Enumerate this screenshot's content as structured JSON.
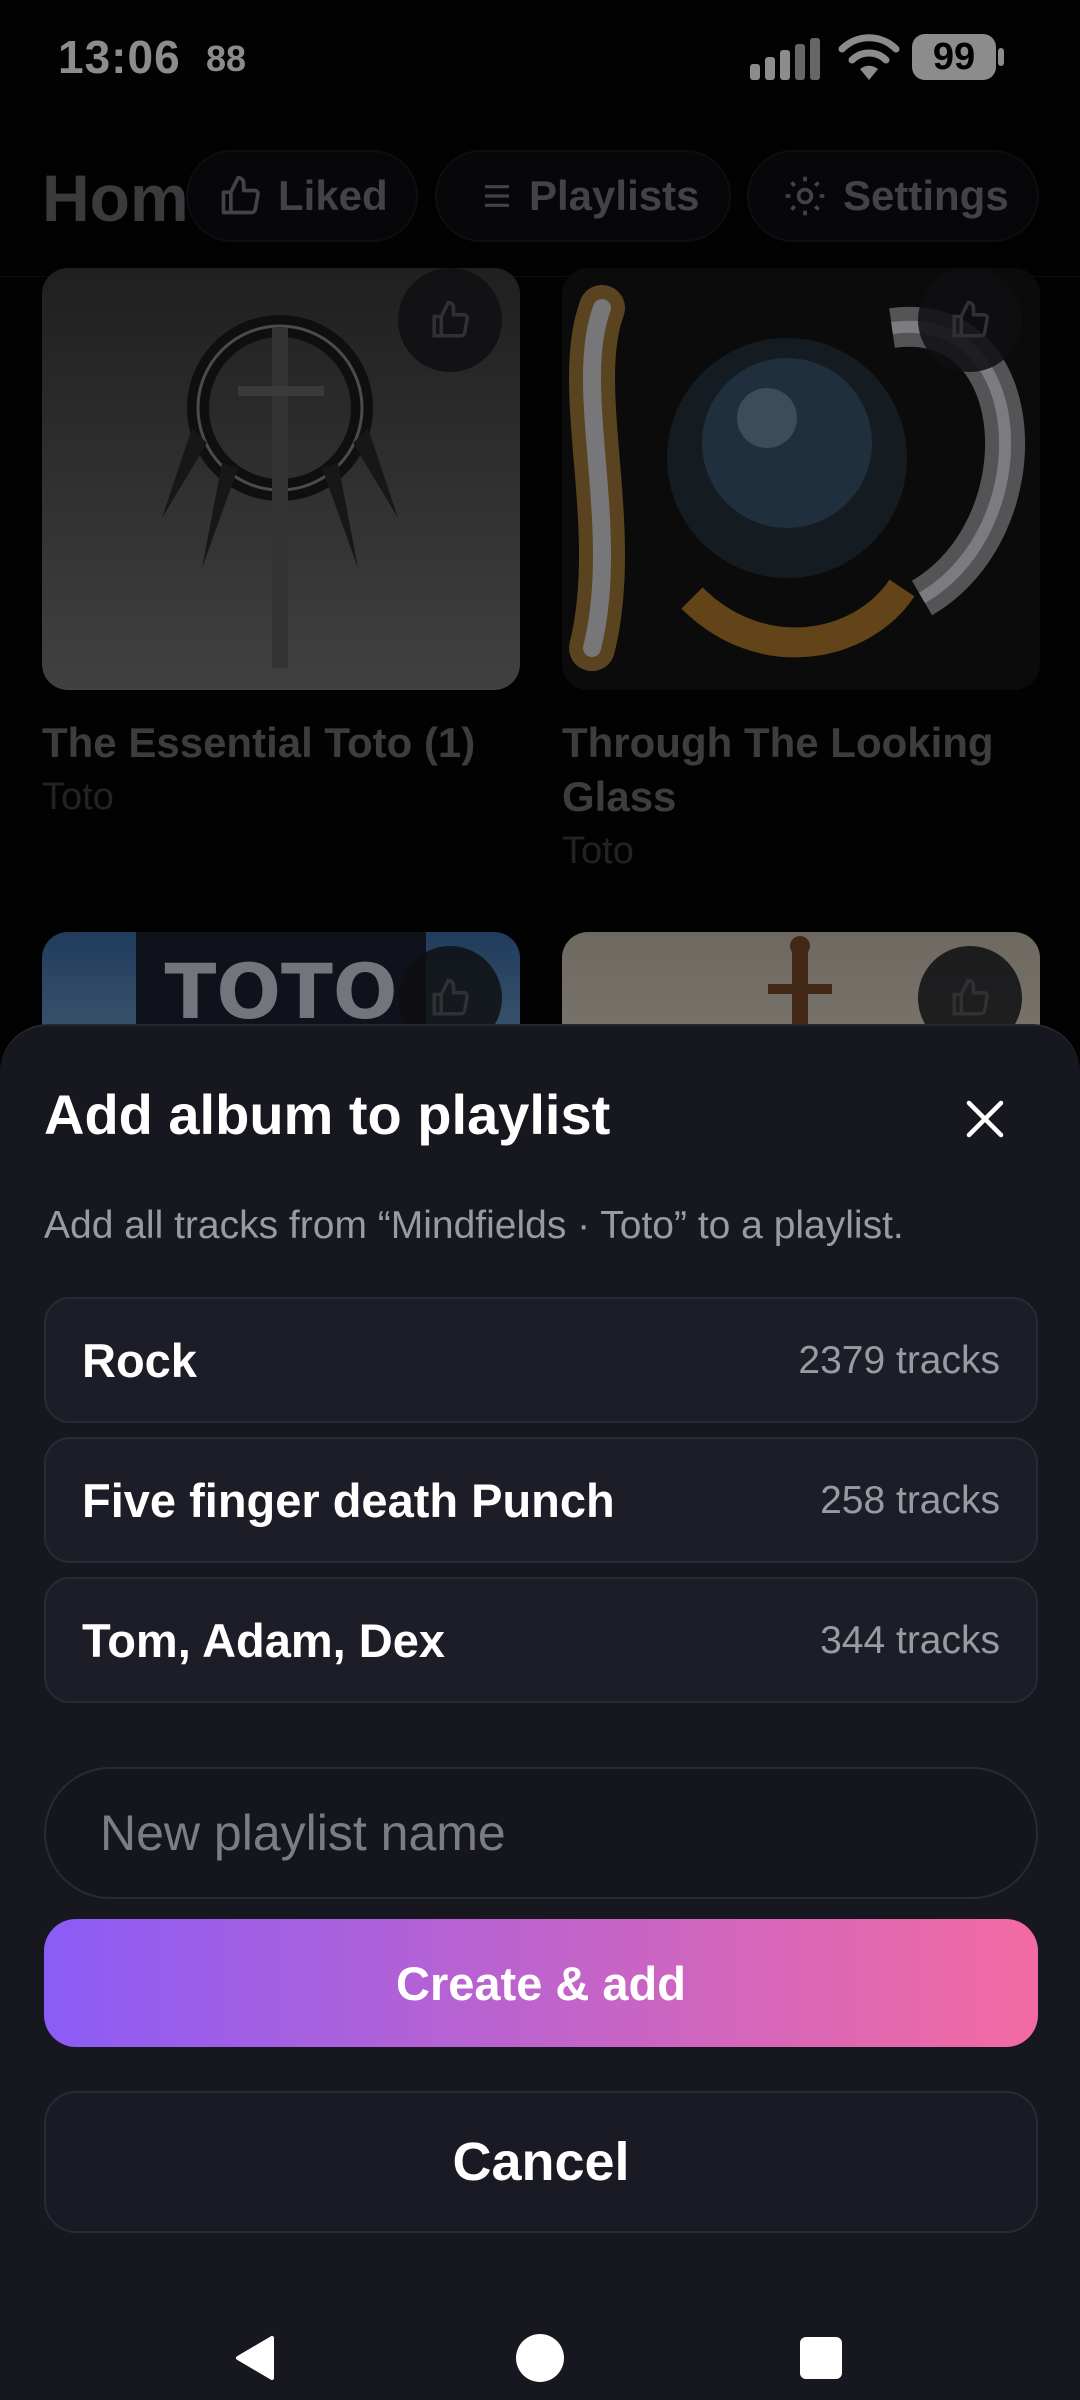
{
  "status_bar": {
    "time": "13:06",
    "notification_count": "88",
    "battery": "99"
  },
  "header": {
    "title": "Home",
    "liked_label": "Liked",
    "playlists_label": "Playlists",
    "settings_label": "Settings"
  },
  "albums": [
    {
      "title": "The Essential Toto (1)",
      "artist": "Toto"
    },
    {
      "title": "Through The Looking Glass",
      "artist": "Toto"
    },
    {
      "title": "",
      "artist": ""
    },
    {
      "title": "",
      "artist": ""
    }
  ],
  "sheet": {
    "title": "Add album to playlist",
    "subtitle": "Add all tracks from “Mindfields · Toto” to a playlist.",
    "playlists": [
      {
        "name": "Rock",
        "count": "2379 tracks"
      },
      {
        "name": "Five finger death Punch",
        "count": "258 tracks"
      },
      {
        "name": "Tom, Adam, Dex",
        "count": "344 tracks"
      }
    ],
    "new_playlist_placeholder": "New playlist name",
    "create_label": "Create & add",
    "cancel_label": "Cancel"
  },
  "colors": {
    "accent_start": "#8b5cf6",
    "accent_end": "#f36aa2",
    "sheet_bg": "#17171f"
  }
}
